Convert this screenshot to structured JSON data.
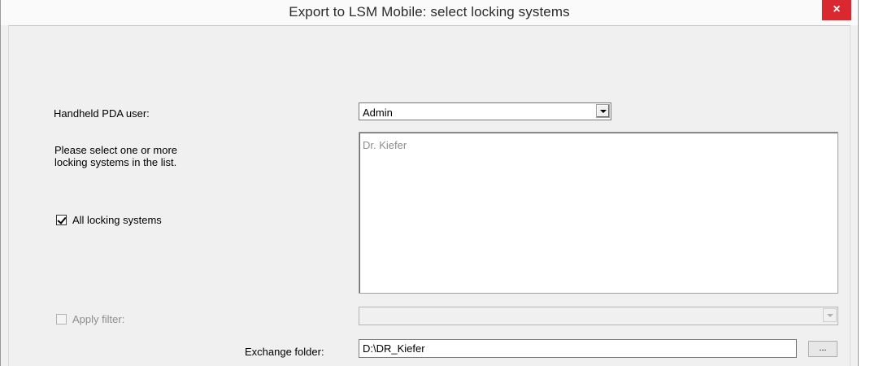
{
  "window": {
    "title": "Export to LSM Mobile: select locking systems",
    "close_glyph": "×"
  },
  "form": {
    "pda_user_label": "Handheld PDA user:",
    "pda_user_value": "Admin",
    "instructions_line1": "Please select one or more",
    "instructions_line2": "locking systems in the list.",
    "locking_systems": [
      "Dr. Kiefer"
    ],
    "all_locking_systems_label": "All locking systems",
    "all_locking_systems_checked": true,
    "apply_filter_label": "Apply filter:",
    "apply_filter_checked": false,
    "filter_value": "",
    "exchange_folder_label": "Exchange folder:",
    "exchange_folder_value": "D:\\DR_Kiefer",
    "browse_label": "..."
  },
  "colors": {
    "close_button": "#d9282f",
    "dialog_background": "#f0f0f0"
  },
  "icons": {
    "close": "close-icon",
    "dropdown": "chevron-down-icon"
  }
}
